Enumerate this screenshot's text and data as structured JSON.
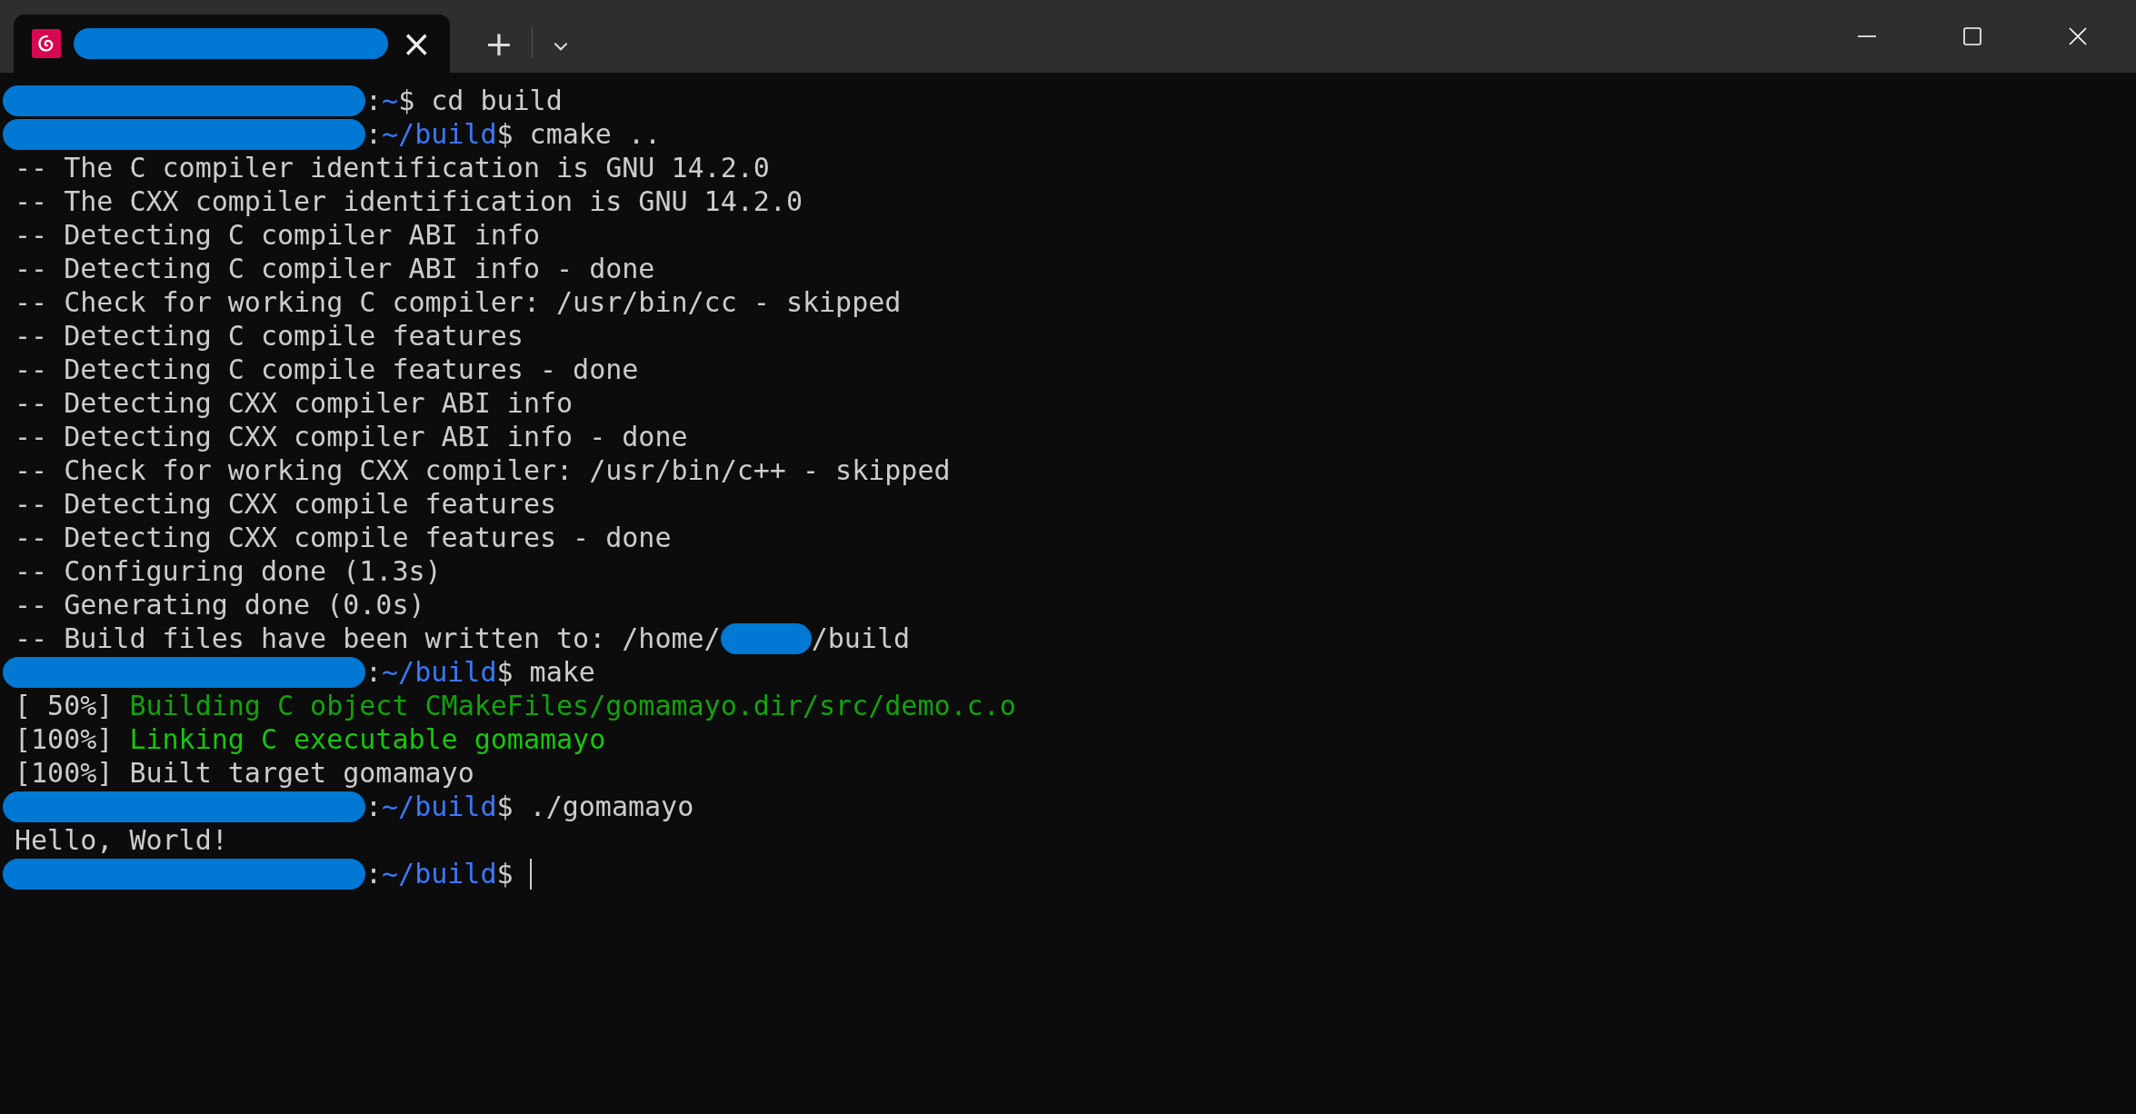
{
  "tab": {
    "selected": true,
    "close": "×"
  },
  "tab_bar": {
    "new_tab": "+"
  },
  "lines": [
    {
      "segments": [
        {
          "kind": "redacted"
        },
        {
          "kind": "text",
          "text": ":"
        },
        {
          "kind": "path",
          "text": "~"
        },
        {
          "kind": "text",
          "text": "$ cd build"
        }
      ]
    },
    {
      "segments": [
        {
          "kind": "redacted"
        },
        {
          "kind": "text",
          "text": ":"
        },
        {
          "kind": "path",
          "text": "~/build"
        },
        {
          "kind": "text",
          "text": "$ cmake .."
        }
      ]
    },
    {
      "segments": [
        {
          "kind": "text",
          "text": "-- The C compiler identification is GNU 14.2.0"
        }
      ]
    },
    {
      "segments": [
        {
          "kind": "text",
          "text": "-- The CXX compiler identification is GNU 14.2.0"
        }
      ]
    },
    {
      "segments": [
        {
          "kind": "text",
          "text": "-- Detecting C compiler ABI info"
        }
      ]
    },
    {
      "segments": [
        {
          "kind": "text",
          "text": "-- Detecting C compiler ABI info - done"
        }
      ]
    },
    {
      "segments": [
        {
          "kind": "text",
          "text": "-- Check for working C compiler: /usr/bin/cc - skipped"
        }
      ]
    },
    {
      "segments": [
        {
          "kind": "text",
          "text": "-- Detecting C compile features"
        }
      ]
    },
    {
      "segments": [
        {
          "kind": "text",
          "text": "-- Detecting C compile features - done"
        }
      ]
    },
    {
      "segments": [
        {
          "kind": "text",
          "text": "-- Detecting CXX compiler ABI info"
        }
      ]
    },
    {
      "segments": [
        {
          "kind": "text",
          "text": "-- Detecting CXX compiler ABI info - done"
        }
      ]
    },
    {
      "segments": [
        {
          "kind": "text",
          "text": "-- Check for working CXX compiler: /usr/bin/c++ - skipped"
        }
      ]
    },
    {
      "segments": [
        {
          "kind": "text",
          "text": "-- Detecting CXX compile features"
        }
      ]
    },
    {
      "segments": [
        {
          "kind": "text",
          "text": "-- Detecting CXX compile features - done"
        }
      ]
    },
    {
      "segments": [
        {
          "kind": "text",
          "text": "-- Configuring done (1.3s)"
        }
      ]
    },
    {
      "segments": [
        {
          "kind": "text",
          "text": "-- Generating done (0.0s)"
        }
      ]
    },
    {
      "segments": [
        {
          "kind": "text",
          "text": "-- Build files have been written to: /home/"
        },
        {
          "kind": "redacted-short"
        },
        {
          "kind": "text",
          "text": "/build"
        }
      ]
    },
    {
      "segments": [
        {
          "kind": "redacted"
        },
        {
          "kind": "text",
          "text": ":"
        },
        {
          "kind": "path",
          "text": "~/build"
        },
        {
          "kind": "text",
          "text": "$ make"
        }
      ]
    },
    {
      "segments": [
        {
          "kind": "text",
          "text": "[ 50%] "
        },
        {
          "kind": "green",
          "text": "Building C object CMakeFiles/gomamayo.dir/src/demo.c.o"
        }
      ]
    },
    {
      "segments": [
        {
          "kind": "text",
          "text": "[100%] "
        },
        {
          "kind": "bright-green",
          "text": "Linking C executable gomamayo"
        }
      ]
    },
    {
      "segments": [
        {
          "kind": "text",
          "text": "[100%] Built target gomamayo"
        }
      ]
    },
    {
      "segments": [
        {
          "kind": "redacted"
        },
        {
          "kind": "text",
          "text": ":"
        },
        {
          "kind": "path",
          "text": "~/build"
        },
        {
          "kind": "text",
          "text": "$ ./gomamayo"
        }
      ]
    },
    {
      "segments": [
        {
          "kind": "text",
          "text": "Hello, World!"
        }
      ]
    },
    {
      "segments": [
        {
          "kind": "redacted"
        },
        {
          "kind": "text",
          "text": ":"
        },
        {
          "kind": "path",
          "text": "~/build"
        },
        {
          "kind": "text",
          "text": "$ "
        },
        {
          "kind": "cursor"
        }
      ]
    }
  ]
}
